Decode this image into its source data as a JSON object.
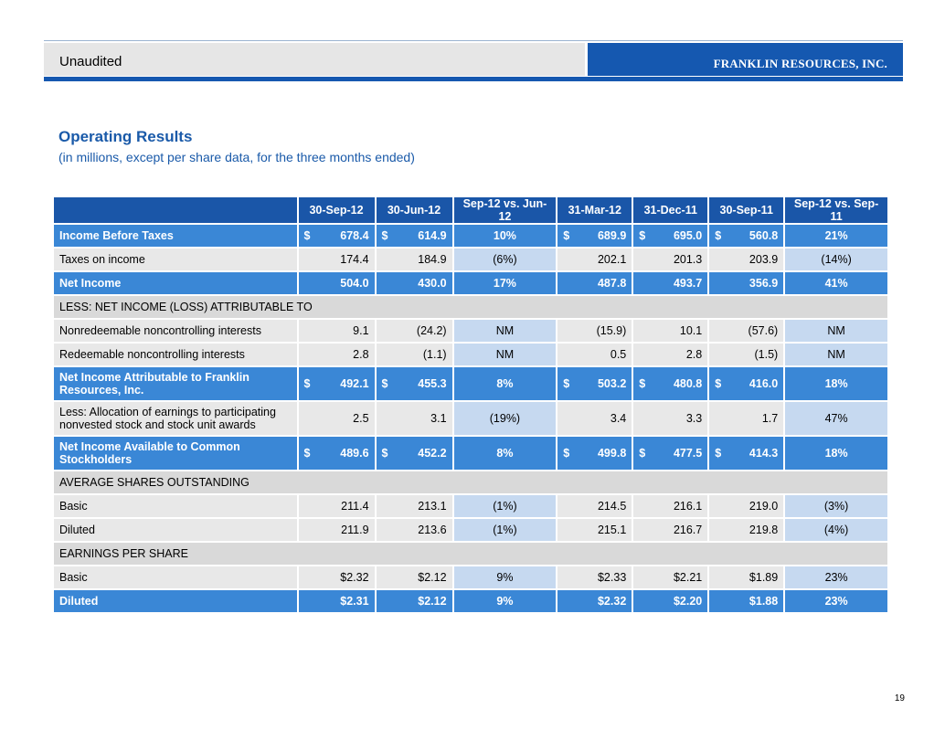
{
  "header": {
    "left_label": "Unaudited",
    "company": "FRANKLIN RESOURCES, INC."
  },
  "title": "Operating Results",
  "subtitle": "(in millions, except per share data, for the three months ended)",
  "columns": [
    "",
    "30-Sep-12",
    "30-Jun-12",
    "Sep-12 vs. Jun-12",
    "31-Mar-12",
    "31-Dec-11",
    "30-Sep-11",
    "Sep-12 vs. Sep-11"
  ],
  "rows": {
    "income_before_taxes": {
      "label": "Income Before Taxes",
      "values": [
        "678.4",
        "614.9",
        "10%",
        "689.9",
        "695.0",
        "560.8",
        "21%"
      ]
    },
    "taxes_on_income": {
      "label": "Taxes on income",
      "values": [
        "174.4",
        "184.9",
        "(6%)",
        "202.1",
        "201.3",
        "203.9",
        "(14%)"
      ]
    },
    "net_income": {
      "label": "Net Income",
      "values": [
        "504.0",
        "430.0",
        "17%",
        "487.8",
        "493.7",
        "356.9",
        "41%"
      ]
    },
    "less_section": {
      "label": "LESS: NET INCOME (LOSS) ATTRIBUTABLE TO"
    },
    "nonredeemable": {
      "label": "Nonredeemable noncontrolling interests",
      "values": [
        "9.1",
        "(24.2)",
        "NM",
        "(15.9)",
        "10.1",
        "(57.6)",
        "NM"
      ]
    },
    "redeemable": {
      "label": "Redeemable noncontrolling interests",
      "values": [
        "2.8",
        "(1.1)",
        "NM",
        "0.5",
        "2.8",
        "(1.5)",
        "NM"
      ]
    },
    "ni_attrib": {
      "label": "Net Income Attributable to Franklin Resources, Inc.",
      "values": [
        "492.1",
        "455.3",
        "8%",
        "503.2",
        "480.8",
        "416.0",
        "18%"
      ]
    },
    "allocation": {
      "label": "Less: Allocation of earnings to participating nonvested stock and stock unit awards",
      "values": [
        "2.5",
        "3.1",
        "(19%)",
        "3.4",
        "3.3",
        "1.7",
        "47%"
      ]
    },
    "ni_available": {
      "label": "Net Income Available to Common Stockholders",
      "values": [
        "489.6",
        "452.2",
        "8%",
        "499.8",
        "477.5",
        "414.3",
        "18%"
      ]
    },
    "avg_section": {
      "label": "AVERAGE SHARES OUTSTANDING"
    },
    "shares_basic": {
      "label": "Basic",
      "values": [
        "211.4",
        "213.1",
        "(1%)",
        "214.5",
        "216.1",
        "219.0",
        "(3%)"
      ]
    },
    "shares_diluted": {
      "label": "Diluted",
      "values": [
        "211.9",
        "213.6",
        "(1%)",
        "215.1",
        "216.7",
        "219.8",
        "(4%)"
      ]
    },
    "eps_section": {
      "label": "EARNINGS PER SHARE"
    },
    "eps_basic": {
      "label": "Basic",
      "values": [
        "$2.32",
        "$2.12",
        "9%",
        "$2.33",
        "$2.21",
        "$1.89",
        "23%"
      ]
    },
    "eps_diluted": {
      "label": "Diluted",
      "values": [
        "$2.31",
        "$2.12",
        "9%",
        "$2.32",
        "$2.20",
        "$1.88",
        "23%"
      ]
    }
  },
  "currency_symbol": "$",
  "page_number": "19",
  "colors": {
    "brand_blue": "#1558b0",
    "highlight_row": "#3a87d6",
    "pct_cell": "#c6d9f0"
  }
}
